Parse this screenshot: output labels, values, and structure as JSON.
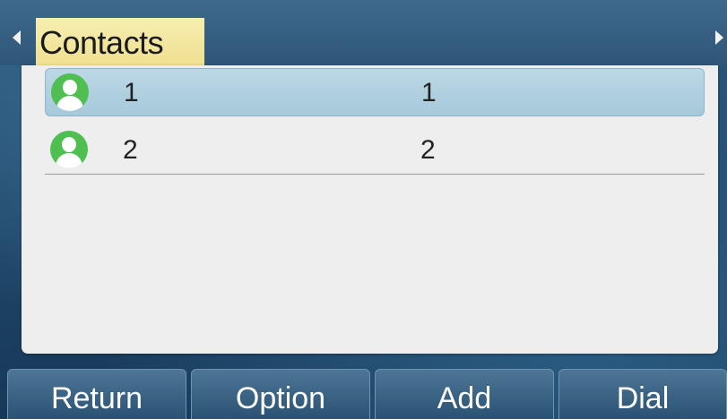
{
  "header": {
    "title": "Contacts",
    "left_arrow_icon": "arrow-left-icon",
    "right_arrow_icon": "arrow-right-icon"
  },
  "contacts": [
    {
      "name": "1",
      "number": "1",
      "selected": true,
      "icon": "contact-avatar-icon"
    },
    {
      "name": "2",
      "number": "2",
      "selected": false,
      "icon": "contact-avatar-icon"
    }
  ],
  "softkeys": {
    "return_label": "Return",
    "option_label": "Option",
    "add_label": "Add",
    "dial_label": "Dial"
  },
  "colors": {
    "title_highlight": "#f2e6a0",
    "selected_row": "#b0d0e0",
    "avatar": "#4fbf52",
    "background": "#2a5578"
  }
}
